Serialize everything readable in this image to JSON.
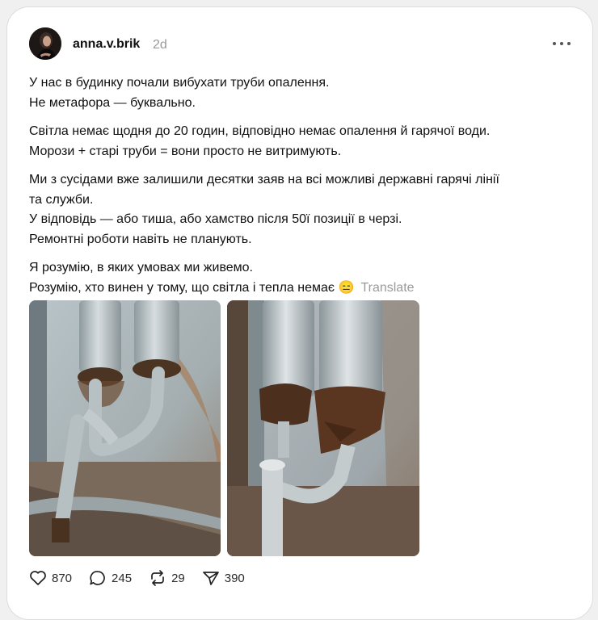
{
  "post": {
    "username": "anna.v.brik",
    "time": "2d",
    "paragraphs": [
      [
        "У нас в будинку почали вибухати труби опалення.",
        "Не метафора — буквально."
      ],
      [
        "Світла немає щодня до 20 годин, відповідно немає опалення й гарячої води.",
        "Морози + старі труби = вони просто не витримують."
      ],
      [
        "Ми з сусідами вже залишили десятки заяв на всі можливі державні гарячі лінії",
        "та служби.",
        "У відповідь — або тиша, або хамство після 50ї позиції в черзі.",
        "Ремонтні роботи навіть не планують."
      ],
      [
        "Я розумію, в яких умовах ми живемо.",
        "Розумію, хто винен у тому, що світла і тепла немає 😑"
      ]
    ],
    "translate_label": "Translate",
    "likes": "870",
    "replies": "245",
    "reposts": "29",
    "shares": "390"
  },
  "icons": {
    "more": "more-dots-icon",
    "like": "heart-icon",
    "reply": "comment-bubble-icon",
    "repost": "repost-icon",
    "share": "send-icon"
  },
  "colors": {
    "muted": "#999999",
    "text": "#101010",
    "card_border": "#dcdcdc"
  }
}
